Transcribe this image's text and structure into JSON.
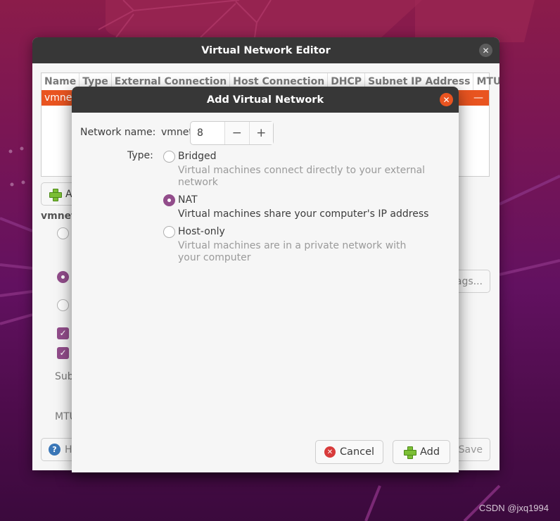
{
  "main_window": {
    "title": "Virtual Network Editor",
    "close_icon": "close-icon",
    "table": {
      "columns": [
        "Name",
        "Type",
        "External Connection",
        "Host Connection",
        "DHCP",
        "Subnet IP Address",
        "MTU"
      ],
      "selected_row": {
        "name": "vmnet",
        "mtu": "—"
      }
    },
    "add_button_partial": "A",
    "section_label_partial": "vmnet",
    "subnet_label_partial": "Sub",
    "mtu_label_partial": "MTU",
    "settings_button_partial": "ags...",
    "help_button_partial": "H",
    "save_button_partial": "Save",
    "checkboxes": [
      true,
      true
    ],
    "radios": [
      false,
      true,
      false
    ]
  },
  "dialog": {
    "title": "Add Virtual Network",
    "network_name_label": "Network name:",
    "network_prefix": "vmnet",
    "network_number": "8",
    "decrement_symbol": "−",
    "increment_symbol": "+",
    "type_label": "Type:",
    "options": [
      {
        "label": "Bridged",
        "description": "Virtual machines connect directly to your external network",
        "selected": false
      },
      {
        "label": "NAT",
        "description": "Virtual machines share your computer's IP address",
        "selected": true
      },
      {
        "label": "Host-only",
        "description": "Virtual machines are in a private network with your computer",
        "selected": false
      }
    ],
    "cancel_label": "Cancel",
    "add_label": "Add"
  },
  "watermark": "CSDN @jxq1994",
  "colors": {
    "accent": "#e95420",
    "radio_checked": "#924d8b",
    "titlebar": "#373737"
  }
}
